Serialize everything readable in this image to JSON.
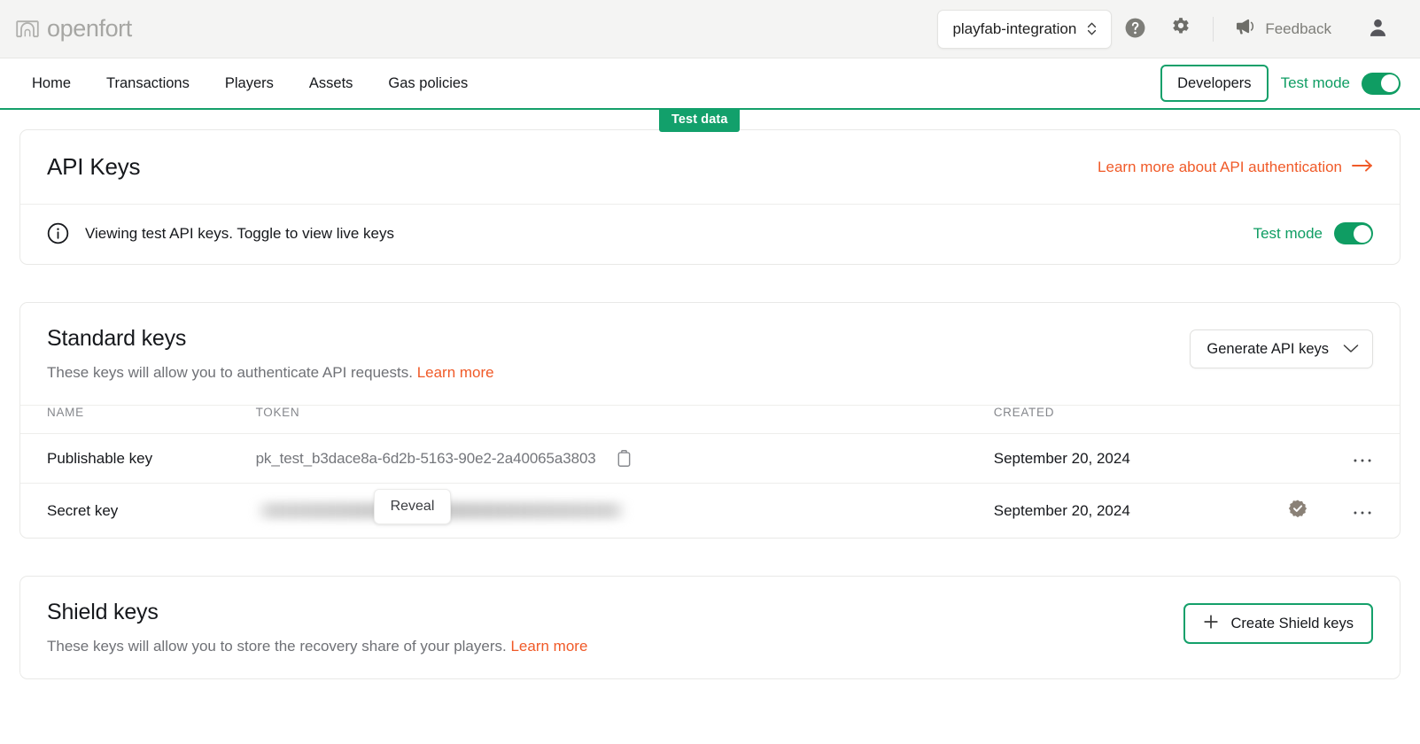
{
  "colors": {
    "brand_green": "#14a06a",
    "accent_orange": "#f05a28",
    "header_bg": "#f4f4f3",
    "muted_text": "#6f7176"
  },
  "topbar": {
    "logo_icon": "openfort-fort-icon",
    "brand": "openfort",
    "project_select": {
      "value": "playfab-integration",
      "icon": "chevron-up-down-icon"
    },
    "help_icon": "help-circle-icon",
    "settings_icon": "gear-icon",
    "feedback": {
      "icon": "megaphone-icon",
      "label": "Feedback"
    },
    "account_icon": "user-avatar-icon"
  },
  "nav": {
    "links": [
      {
        "label": "Home"
      },
      {
        "label": "Transactions"
      },
      {
        "label": "Players"
      },
      {
        "label": "Assets"
      },
      {
        "label": "Gas policies"
      }
    ],
    "developers_label": "Developers",
    "test_mode_label": "Test mode",
    "test_mode_on": true,
    "test_data_badge": "Test data"
  },
  "api_keys_card": {
    "title": "API Keys",
    "learn_link": "Learn more about API authentication",
    "learn_link_icon": "arrow-right-icon",
    "banner": {
      "icon": "info-circle-icon",
      "text": "Viewing test API keys. Toggle to view live keys",
      "toggle_label": "Test mode",
      "toggle_on": true
    }
  },
  "standard_keys": {
    "title": "Standard keys",
    "subtitle_text": "These keys will allow you to authenticate API requests.",
    "subtitle_link": "Learn more",
    "generate_button": {
      "label": "Generate API keys",
      "icon": "chevron-down-icon"
    },
    "table": {
      "columns": [
        "NAME",
        "TOKEN",
        "CREATED"
      ],
      "rows": [
        {
          "name": "Publishable key",
          "token": "pk_test_b3dace8a-6d2b-5163-90e2-2a40065a3803",
          "token_hidden": false,
          "copy_icon": "clipboard-copy-icon",
          "created": "September 20, 2024",
          "verified": false,
          "menu_icon": "ellipsis-icon"
        },
        {
          "name": "Secret key",
          "token": "",
          "token_hidden": true,
          "reveal_label": "Reveal",
          "created": "September 20, 2024",
          "verified": true,
          "verified_icon": "badge-check-icon",
          "menu_icon": "ellipsis-icon"
        }
      ]
    }
  },
  "shield_keys": {
    "title": "Shield keys",
    "subtitle_text": "These keys will allow you to store the recovery share of your players.",
    "subtitle_link": "Learn more",
    "create_button": {
      "label": "Create Shield keys",
      "icon": "plus-icon"
    }
  }
}
